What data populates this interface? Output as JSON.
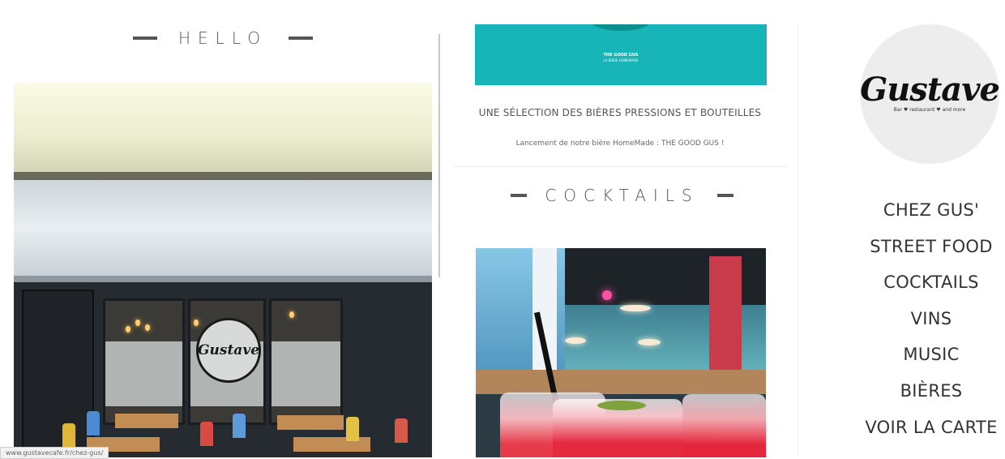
{
  "left": {
    "hello_heading": "HELLO",
    "storefront_logo": "Gustave",
    "status_url": "www.gustavecafe.fr/chez-gus/"
  },
  "middle": {
    "banner": {
      "brand": "THE GOOD GUS",
      "fine_print": "LA BIÈRE HOMEMADE"
    },
    "beer_title": "UNE SÉLECTION DES BIÈRES PRESSIONS ET BOUTEILLES",
    "beer_subtitle": "Lancement de notre bière HomeMade : THE GOOD GUS !",
    "cocktails_heading": "COCKTAILS"
  },
  "brand": {
    "logo_word": "Gustave",
    "logo_tagline": "Bar ♥ restaurant ♥ and more"
  },
  "nav": {
    "items": [
      {
        "label": "CHEZ GUS'"
      },
      {
        "label": "STREET FOOD"
      },
      {
        "label": "COCKTAILS"
      },
      {
        "label": "VINS"
      },
      {
        "label": "MUSIC"
      },
      {
        "label": "BIÈRES"
      },
      {
        "label": "VOIR LA CARTE"
      }
    ]
  },
  "colors": {
    "banner_teal": "#17b5b8",
    "text_gray": "#555555",
    "logo_bg": "#ededed"
  }
}
